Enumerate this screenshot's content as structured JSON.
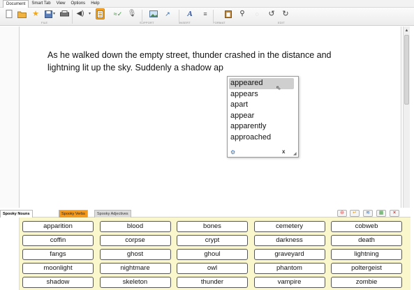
{
  "menubar": {
    "items": [
      "Document",
      "Smart Tab",
      "View",
      "Options",
      "Help"
    ]
  },
  "toolbar": {
    "groups": [
      "FILE",
      "SUPPORT",
      "INSERT",
      "FORMAT",
      "EDIT"
    ],
    "icons": [
      "new-document-icon",
      "open-folder-icon",
      "favorite-star-icon",
      "save-icon",
      "print-icon",
      "speak-icon",
      "word-prediction-icon",
      "spell-check-icon",
      "microphone-icon",
      "insert-image-icon",
      "insert-link-icon",
      "font-icon",
      "paragraph-align-icon",
      "paste-icon",
      "find-icon",
      "clear-icon",
      "undo-icon",
      "redo-icon"
    ],
    "accent_color": "#f6a623"
  },
  "document": {
    "line1": "As he walked down the empty street, thunder crashed in the distance and",
    "line2": "lightning lit up the sky. Suddenly a shadow ap"
  },
  "prediction": {
    "items": [
      "appeared",
      "appears",
      "apart",
      "appear",
      "apparently",
      "approached"
    ],
    "selected_index": 0,
    "close_label": "x"
  },
  "wordbank": {
    "tabs": [
      "Spooky Nouns",
      "Spooky Verbs",
      "Spooky Adjectives"
    ],
    "active_tab": "Spooky Nouns",
    "tab_colors": {
      "nouns": "#ffffff",
      "verbs": "#f39a1e",
      "adjs": "#dcdcdc"
    },
    "background": "#fbf7cd",
    "words": [
      "apparition",
      "blood",
      "bones",
      "cemetery",
      "cobweb",
      "coffin",
      "corpse",
      "crypt",
      "darkness",
      "death",
      "fangs",
      "ghost",
      "ghoul",
      "graveyard",
      "lightning",
      "moonlight",
      "nightmare",
      "owl",
      "phantom",
      "poltergeist",
      "shadow",
      "skeleton",
      "thunder",
      "vampire",
      "zombie"
    ]
  }
}
